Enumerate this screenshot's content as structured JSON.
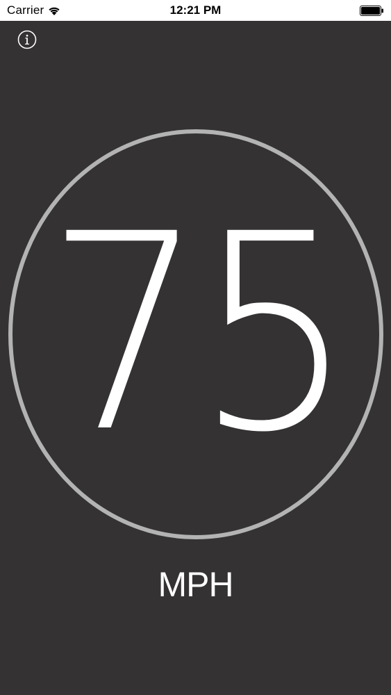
{
  "status_bar": {
    "carrier": "Carrier",
    "time": "12:21 PM",
    "wifi_icon": "wifi-icon",
    "battery_icon": "battery-icon"
  },
  "toolbar": {
    "info_icon": "info-icon",
    "info_glyph": "i"
  },
  "speedometer": {
    "speed": "75",
    "unit": "MPH",
    "ring_color": "#b3b3b3",
    "background_color": "#343233",
    "text_color": "#ffffff"
  }
}
